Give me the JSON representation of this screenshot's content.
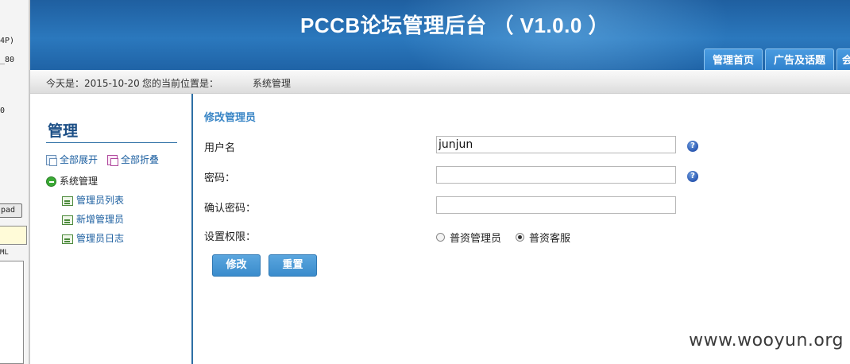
{
  "side_strip": {
    "fragments": [
      "4P)",
      "_80",
      "0",
      "pad",
      "ML"
    ]
  },
  "header": {
    "title": "PCCB论坛管理后台 （ V1.0.0 ）",
    "nav_tabs": [
      "管理首页",
      "广告及话题",
      "会"
    ]
  },
  "breadcrumb": {
    "date_text": "今天是：2015-10-20",
    "location_label": "您的当前位置是：",
    "location_value": "系统管理"
  },
  "sidebar": {
    "title": "管理",
    "expand_all": "全部展开",
    "collapse_all": "全部折叠",
    "group": "系统管理",
    "items": [
      "管理员列表",
      "新增管理员",
      "管理员日志"
    ]
  },
  "form": {
    "title": "修改管理员",
    "username_label": "用户名",
    "username_value": "junjun",
    "password_label": "密码：",
    "password_value": "",
    "confirm_label": "确认密码：",
    "confirm_value": "",
    "permission_label": "设置权限：",
    "permission_options": [
      "普资管理员",
      "普资客服"
    ],
    "permission_selected": "普资客服",
    "submit_label": "修改",
    "reset_label": "重置"
  },
  "icons": {
    "help": "question-icon"
  },
  "watermark": "www.wooyun.org",
  "colors": {
    "header_blue": "#2b78bd",
    "accent_blue": "#3a86c6",
    "button_blue": "#4a99d6"
  }
}
